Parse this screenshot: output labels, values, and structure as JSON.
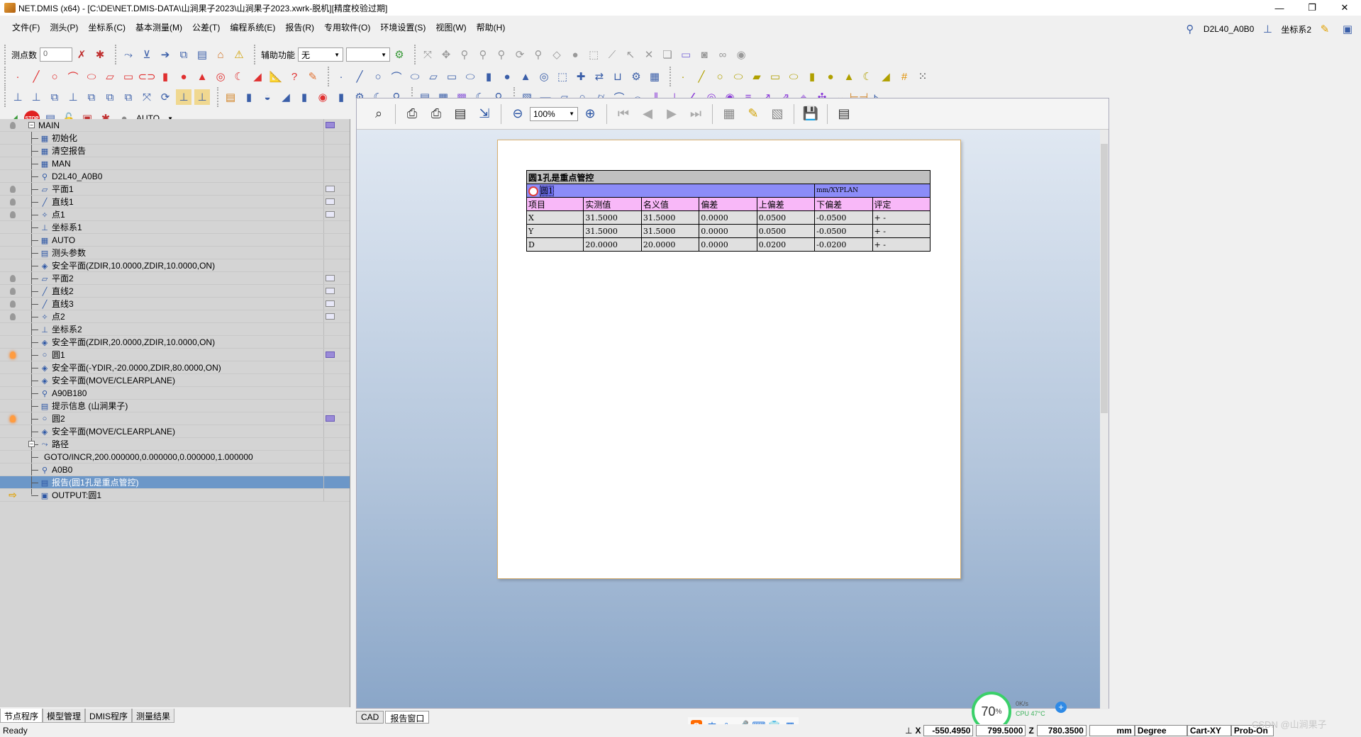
{
  "window": {
    "title": "NET.DMIS (x64) - [C:\\DE\\NET.DMIS-DATA\\山涧果子2023\\山涧果子2023.xwrk-脱机][精度校验过期]",
    "controls": [
      "—",
      "❐",
      "✕"
    ]
  },
  "menu": {
    "items": [
      "文件(F)",
      "测头(P)",
      "坐标系(C)",
      "基本测量(M)",
      "公差(T)",
      "编程系统(E)",
      "报告(R)",
      "专用软件(O)",
      "环境设置(S)",
      "视图(W)",
      "帮助(H)"
    ],
    "probe": "D2L40_A0B0",
    "coord_system": "坐标系2"
  },
  "toolbar": {
    "points_label": "测点数",
    "points_value": "0",
    "assist_label": "辅助功能",
    "assist_value": "无",
    "mode_value": "AUTO"
  },
  "tree": {
    "items": [
      {
        "label": "MAIN",
        "level": 0,
        "icon": "expand-minus",
        "bulb": "off",
        "right": "purple"
      },
      {
        "label": "初始化",
        "level": 1,
        "icon": "init-icon"
      },
      {
        "label": "清空报告",
        "level": 1,
        "icon": "clear-report-icon"
      },
      {
        "label": "MAN",
        "level": 1,
        "icon": "mode-icon"
      },
      {
        "label": "D2L40_A0B0",
        "level": 1,
        "icon": "probe-icon"
      },
      {
        "label": "平面1",
        "level": 1,
        "icon": "plane-icon",
        "bulb": "off",
        "right": "grey"
      },
      {
        "label": "直线1",
        "level": 1,
        "icon": "line-icon",
        "bulb": "off",
        "right": "grey"
      },
      {
        "label": "点1",
        "level": 1,
        "icon": "point-icon",
        "bulb": "off",
        "right": "grey"
      },
      {
        "label": "坐标系1",
        "level": 1,
        "icon": "csys-icon"
      },
      {
        "label": "AUTO",
        "level": 1,
        "icon": "mode-icon"
      },
      {
        "label": "测头参数",
        "level": 1,
        "icon": "probe-param-icon"
      },
      {
        "label": "安全平面(ZDIR,10.0000,ZDIR,10.0000,ON)",
        "level": 1,
        "icon": "safe-plane-icon"
      },
      {
        "label": "平面2",
        "level": 1,
        "icon": "plane-icon",
        "bulb": "off",
        "right": "grey"
      },
      {
        "label": "直线2",
        "level": 1,
        "icon": "line-icon",
        "bulb": "off",
        "right": "grey"
      },
      {
        "label": "直线3",
        "level": 1,
        "icon": "line-icon",
        "bulb": "off",
        "right": "grey"
      },
      {
        "label": "点2",
        "level": 1,
        "icon": "point-icon",
        "bulb": "off",
        "right": "grey"
      },
      {
        "label": "坐标系2",
        "level": 1,
        "icon": "csys-icon"
      },
      {
        "label": "安全平面(ZDIR,20.0000,ZDIR,10.0000,ON)",
        "level": 1,
        "icon": "safe-plane-icon"
      },
      {
        "label": "圆1",
        "level": 1,
        "icon": "circle-icon",
        "bulb": "lit",
        "right": "purple"
      },
      {
        "label": "安全平面(-YDIR,-20.0000,ZDIR,80.0000,ON)",
        "level": 1,
        "icon": "safe-plane-icon"
      },
      {
        "label": "安全平面(MOVE/CLEARPLANE)",
        "level": 1,
        "icon": "safe-plane-icon"
      },
      {
        "label": "A90B180",
        "level": 1,
        "icon": "probe-icon"
      },
      {
        "label": "提示信息 (山涧果子)",
        "level": 1,
        "icon": "message-icon"
      },
      {
        "label": "圆2",
        "level": 1,
        "icon": "circle-icon",
        "bulb": "lit",
        "right": "purple"
      },
      {
        "label": "安全平面(MOVE/CLEARPLANE)",
        "level": 1,
        "icon": "safe-plane-icon"
      },
      {
        "label": "路径",
        "level": 1,
        "icon": "path-icon",
        "expander": "-"
      },
      {
        "label": "GOTO/INCR,200.000000,0.000000,0.000000,1.000000",
        "level": 2,
        "icon": ""
      },
      {
        "label": "A0B0",
        "level": 1,
        "icon": "probe-icon"
      },
      {
        "label": "报告(圆1孔是重点管控)",
        "level": 1,
        "icon": "report-icon",
        "selected": true
      },
      {
        "label": "OUTPUT:圆1",
        "level": 1,
        "icon": "output-icon",
        "arrow": true
      }
    ],
    "tabs": [
      "节点程序",
      "模型管理",
      "DMIS程序",
      "测量结果"
    ]
  },
  "report": {
    "zoom": "100%",
    "title": "圆1孔是重点管控",
    "feature": "圆1",
    "unit_plane": "mm/XYPLAN",
    "headers": [
      "项目",
      "实测值",
      "名义值",
      "偏差",
      "上偏差",
      "下偏差",
      "评定"
    ],
    "rows": [
      [
        "X",
        "31.5000",
        "31.5000",
        "0.0000",
        "0.0500",
        "-0.0500",
        "+ -"
      ],
      [
        "Y",
        "31.5000",
        "31.5000",
        "0.0000",
        "0.0500",
        "-0.0500",
        "+ -"
      ],
      [
        "D",
        "20.0000",
        "20.0000",
        "0.0000",
        "0.0200",
        "-0.0200",
        "+ -"
      ]
    ],
    "tabs": [
      "CAD",
      "报告窗口"
    ]
  },
  "status": {
    "ready": "Ready",
    "x_label": "X",
    "x_value": "-550.4950",
    "y_value": "799.5000",
    "z_label": "Z",
    "z_value": "780.3500",
    "unit": "mm",
    "angle": "Degree",
    "cart": "Cart-XY",
    "prob": "Prob-On"
  },
  "cpu": {
    "percent": "70",
    "net": "0K/s",
    "temp": "CPU 47°C"
  },
  "watermark": "CSDN @山涧果子"
}
